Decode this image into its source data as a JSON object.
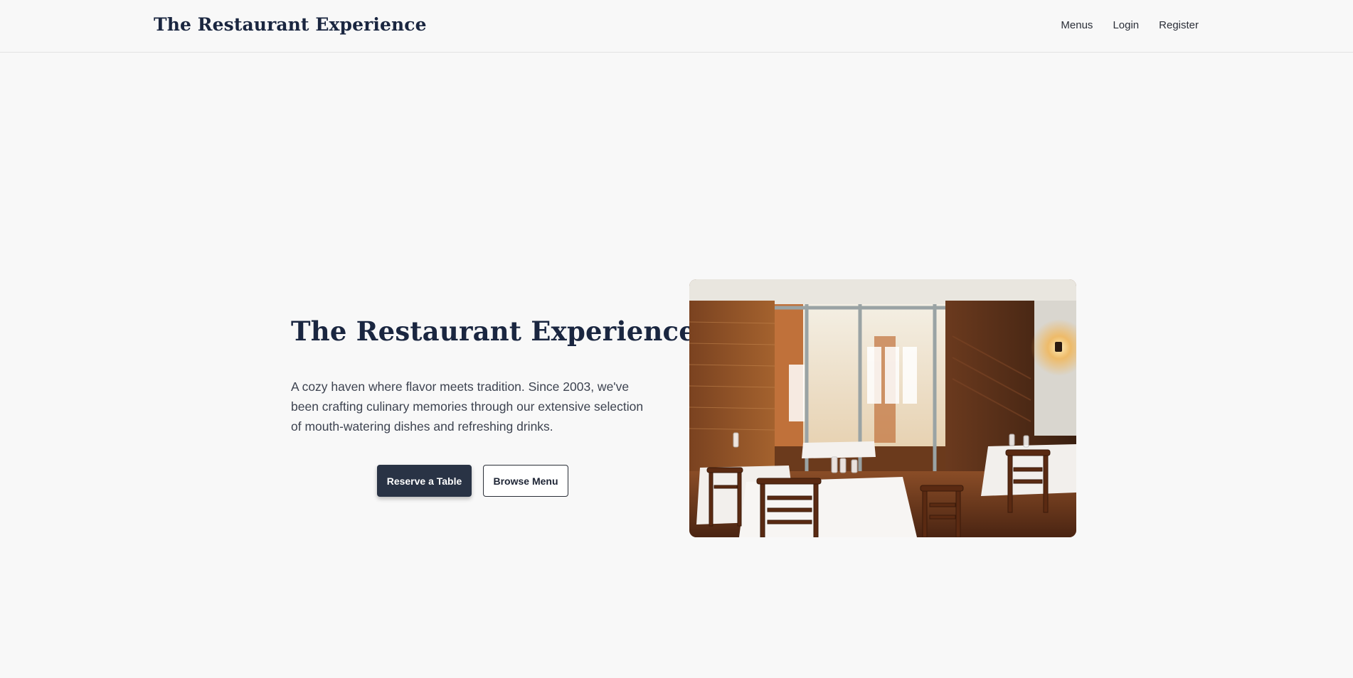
{
  "header": {
    "brand": "The Restaurant Experience",
    "nav": [
      {
        "label": "Menus"
      },
      {
        "label": "Login"
      },
      {
        "label": "Register"
      }
    ]
  },
  "hero": {
    "title": "The Restaurant Experience",
    "description": "A cozy haven where flavor meets tradition. Since 2003, we've been crafting culinary memories through our extensive selection of mouth-watering dishes and refreshing drinks.",
    "primary_button": "Reserve a Table",
    "secondary_button": "Browse Menu",
    "image": {
      "subject": "restaurant interior with set tables and wooden chairs"
    }
  },
  "colors": {
    "background": "#f8f8f8",
    "brand_text": "#1a2640",
    "primary_button": "#293345",
    "body_text": "#3d4350"
  }
}
